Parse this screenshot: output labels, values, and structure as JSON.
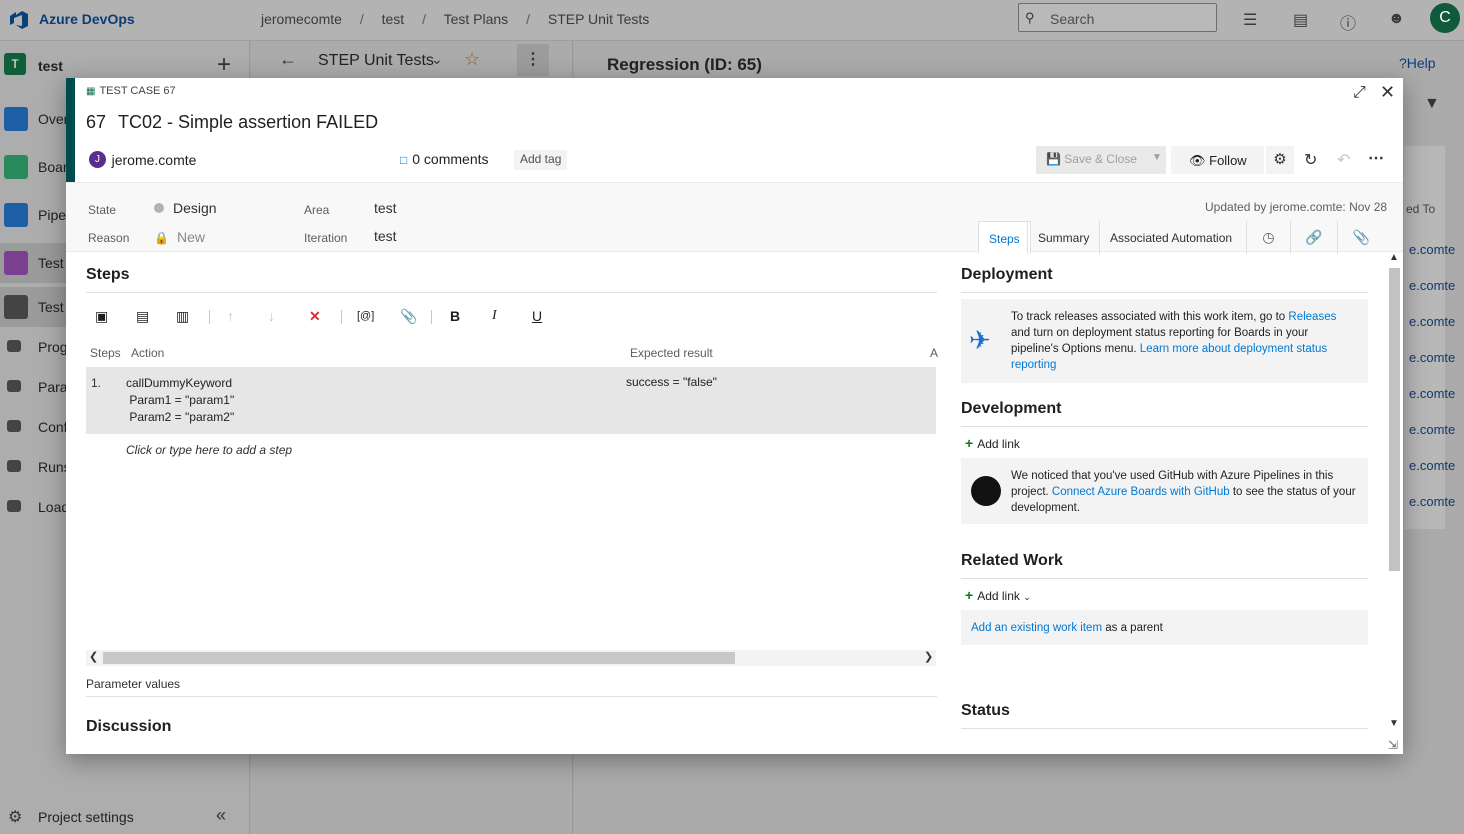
{
  "topbar": {
    "app_name": "Azure DevOps",
    "breadcrumb": [
      "jeromecomte",
      "test",
      "Test Plans",
      "STEP Unit Tests"
    ],
    "breadcrumb_sep": "/",
    "search_placeholder": "Search",
    "user_initial": "C"
  },
  "leftnav": {
    "project_initial": "T",
    "project_name": "test",
    "items": [
      {
        "label": "Over",
        "icon": "overview-icon",
        "color": "#1f5fa8"
      },
      {
        "label": "Boar",
        "icon": "boards-icon",
        "color": "#2b8a5c"
      },
      {
        "label": "Pipel",
        "icon": "pipelines-icon",
        "color": "#1f5fa8"
      },
      {
        "label": "Test",
        "icon": "test-plans-icon",
        "color": "#7a3f8f"
      },
      {
        "label": "Test",
        "icon": "test-plan-page-icon",
        "color": "#444444"
      },
      {
        "label": "Prog",
        "icon": "progress-report-icon",
        "color": "#444444"
      },
      {
        "label": "Para",
        "icon": "parameters-icon",
        "color": "#444444"
      },
      {
        "label": "Conf",
        "icon": "configurations-icon",
        "color": "#444444"
      },
      {
        "label": "Runs",
        "icon": "runs-icon",
        "color": "#444444"
      },
      {
        "label": "Load",
        "icon": "load-test-icon",
        "color": "#444444"
      }
    ],
    "settings_label": "Project settings"
  },
  "midpane": {
    "title": "STEP Unit Tests"
  },
  "rightpane": {
    "title": "Regression (ID: 65)",
    "help": "?Help",
    "list_header": "ed To",
    "list_items": [
      "e.comte",
      "e.comte",
      "e.comte",
      "e.comte",
      "e.comte",
      "e.comte",
      "e.comte",
      "e.comte"
    ]
  },
  "dialog": {
    "type_label": "TEST CASE 67",
    "id": "67",
    "title": "TC02 - Simple assertion FAILED",
    "assignee_initial": "J",
    "assignee": "jerome.comte",
    "comments": "0 comments",
    "add_tag": "Add tag",
    "save_close": "Save & Close",
    "follow": "Follow",
    "fields": {
      "state_label": "State",
      "state_value": "Design",
      "reason_label": "Reason",
      "reason_value": "New",
      "area_label": "Area",
      "area_value": "test",
      "iteration_label": "Iteration",
      "iteration_value": "test"
    },
    "updated": "Updated by jerome.comte: Nov 28",
    "tabs": [
      "Steps",
      "Summary",
      "Associated Automation"
    ],
    "steps": {
      "title": "Steps",
      "col_steps": "Steps",
      "col_action": "Action",
      "col_expected": "Expected result",
      "col_a": "A",
      "rows": [
        {
          "num": "1.",
          "action": "callDummyKeyword\n Param1 = \"param1\"\n Param2 = \"param2\"",
          "expected": "success = \"false\""
        }
      ],
      "add_step": "Click or type here to add a step",
      "parameter_values": "Parameter values",
      "discussion": "Discussion"
    },
    "deployment": {
      "title": "Deployment",
      "text_1": "To track releases associated with this work item, go to ",
      "link_releases": "Releases",
      "text_2": " and turn on deployment status reporting for Boards in your pipeline's Options menu. ",
      "link_learn": "Learn more about deployment status reporting"
    },
    "development": {
      "title": "Development",
      "add_link": "Add link",
      "text_1": "We noticed that you've used GitHub with Azure Pipelines in this project. ",
      "link_connect": "Connect Azure Boards with GitHub",
      "text_2": " to see the status of your development."
    },
    "related": {
      "title": "Related Work",
      "add_link": "Add link",
      "link_existing": "Add an existing work item",
      "text_parent": " as a parent"
    },
    "status_title": "Status"
  }
}
